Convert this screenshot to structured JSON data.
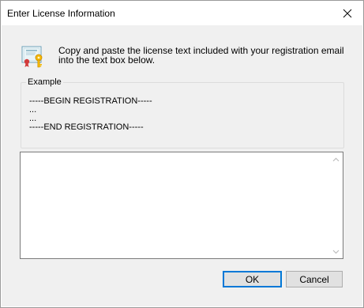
{
  "window": {
    "title": "Enter License Information",
    "close_symbol": "✕"
  },
  "info": {
    "icon": "certificate-key-icon",
    "text": "Copy and paste the license text included with your registration email into the text box below."
  },
  "example": {
    "legend": "Example",
    "lines": [
      "-----BEGIN REGISTRATION-----",
      "...",
      "...",
      "-----END REGISTRATION-----"
    ]
  },
  "license_input": {
    "value": "",
    "placeholder": ""
  },
  "buttons": {
    "ok_label": "OK",
    "cancel_label": "Cancel"
  },
  "colors": {
    "dialog_bg": "#f0f0f0",
    "default_button_border": "#0078d7"
  }
}
